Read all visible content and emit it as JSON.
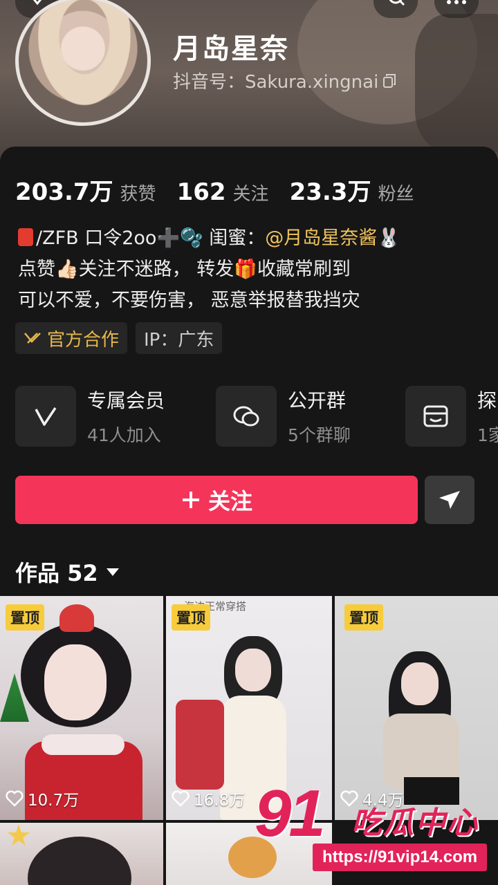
{
  "profile": {
    "nickname": "月岛星奈",
    "douyin_id": "抖音号：Sakura.xingnai"
  },
  "stats": [
    {
      "num": "203.7万",
      "label": "获赞"
    },
    {
      "num": "162",
      "label": "关注"
    },
    {
      "num": "23.3万",
      "label": "粉丝"
    }
  ],
  "bio": {
    "line1_a": "/ZFB 口令2oo➕🫧  闺蜜：",
    "line1_mention": "@月岛星奈酱🐰",
    "line2": "点赞👍🏻关注不迷路， 转发🎁收藏常刷到",
    "line3": "可以不爱，不要伤害， 恶意举报替我挡灾"
  },
  "tags": {
    "official": "官方合作",
    "ip": "IP：广东"
  },
  "features": [
    {
      "title": "专属会员",
      "sub": "41人加入",
      "icon": "v-badge-icon"
    },
    {
      "title": "公开群",
      "sub": "5个群聊",
      "icon": "chat-bubbles-icon"
    },
    {
      "title": "探",
      "sub": "1家",
      "icon": "store-icon"
    }
  ],
  "follow_label": "关注",
  "works": {
    "label": "作品 52"
  },
  "tiles": [
    {
      "pin": "置顶",
      "likes": "10.7万"
    },
    {
      "pin": "置顶",
      "likes": "16.8万",
      "overlay": "海边正常穿搭"
    },
    {
      "pin": "置顶",
      "likes": "4.4万"
    }
  ],
  "watermark": {
    "number": "91",
    "name": "吃瓜中心",
    "url": "https://91vip14.com"
  },
  "colors": {
    "accent": "#f5345a",
    "mention": "#f2c55c",
    "official": "#e6b84b",
    "pin": "#f7cc3c"
  }
}
